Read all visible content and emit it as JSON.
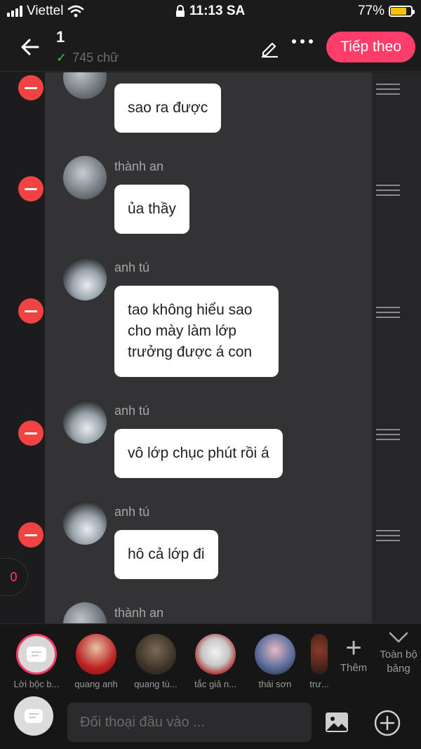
{
  "status_bar": {
    "carrier": "Viettel",
    "time": "11:13 SA",
    "battery": "77%",
    "battery_level": 0.77
  },
  "header": {
    "title": "1",
    "word_count": "745 chữ",
    "next_button": "Tiếp theo"
  },
  "messages": [
    {
      "name": "",
      "text": "sao ra được"
    },
    {
      "name": "thành an",
      "text": "ủa thầy"
    },
    {
      "name": "anh tú",
      "text": "tao không hiểu sao cho mày làm lớp trưởng được á con"
    },
    {
      "name": "anh tú",
      "text": "vô lớp chục phút rồi á"
    },
    {
      "name": "anh tú",
      "text": "hô cả lớp đi"
    },
    {
      "name": "thành an",
      "text": ""
    }
  ],
  "side_badge": "0",
  "characters": [
    {
      "label": "Lời bộc b..."
    },
    {
      "label": "quang anh"
    },
    {
      "label": "quang tù..."
    },
    {
      "label": "tắc giả n..."
    },
    {
      "label": "thái sơn"
    },
    {
      "label": "trư..."
    }
  ],
  "add_more_label": "Thêm",
  "all_board_label": "Toàn bộ bảng",
  "input": {
    "placeholder": "Đối thoại đầu vào ..."
  },
  "icons": {
    "back": "arrow-left-icon",
    "edit": "pencil-icon",
    "more": "more-dots-icon",
    "image": "image-icon",
    "add": "plus-circle-icon"
  },
  "colors": {
    "accent": "#ff3d6b",
    "delete": "#f24343",
    "check": "#2ecc40",
    "battery": "#f5c400"
  }
}
